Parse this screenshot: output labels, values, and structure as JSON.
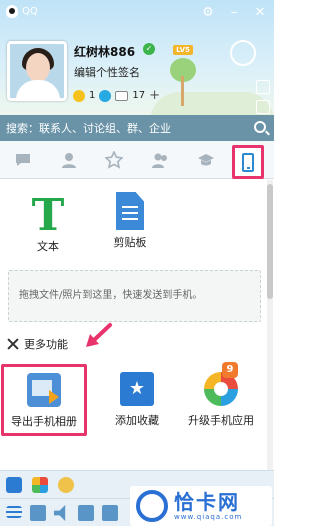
{
  "window": {
    "title": "QQ"
  },
  "profile": {
    "nickname": "红树林886",
    "level_badge": "LV5",
    "signature": "编辑个性签名",
    "stats": [
      {
        "icon": "star-icon",
        "value": "1"
      },
      {
        "icon": "qzone-icon",
        "value": ""
      },
      {
        "icon": "mail-icon",
        "value": "17"
      }
    ],
    "add_label": "+"
  },
  "search": {
    "placeholder": "搜索：联系人、讨论组、群、企业"
  },
  "tabs": [
    {
      "icon": "chat-icon"
    },
    {
      "icon": "contacts-icon"
    },
    {
      "icon": "star-icon"
    },
    {
      "icon": "group-icon"
    },
    {
      "icon": "graduation-cap-icon"
    },
    {
      "icon": "phone-icon",
      "active": true
    }
  ],
  "tools": {
    "text_label": "文本",
    "clipboard_label": "剪贴板",
    "text_glyph": "T"
  },
  "dropzone": {
    "text": "拖拽文件/照片到这里，快速发送到手机。"
  },
  "more": {
    "label": "更多功能"
  },
  "apps": [
    {
      "label": "导出手机相册",
      "icon": "export-album-icon",
      "highlighted": true
    },
    {
      "label": "添加收藏",
      "icon": "bookmark-icon"
    },
    {
      "label": "升级手机应用",
      "icon": "app-upgrade-icon",
      "badge": "9"
    }
  ],
  "watermark": {
    "title": "恰卡网",
    "url": "www.qiaqa.com"
  },
  "colors": {
    "highlight": "#e8336d",
    "search_bg": "#6a93a8",
    "text_green": "#24a84b",
    "accent_blue": "#2a6fd3"
  }
}
